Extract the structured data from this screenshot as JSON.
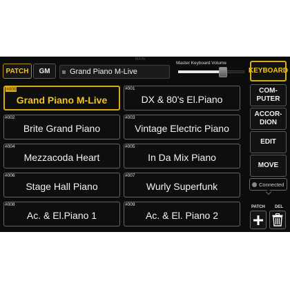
{
  "header": {
    "small_title": "MAIN"
  },
  "tabs": {
    "patch": "PATCH",
    "gm": "GM"
  },
  "current_patch": "Grand Piano M-Live",
  "master_volume": {
    "label": "Master Keyboard Volume",
    "level": 0.68
  },
  "side_buttons": {
    "keyboard": "KEYBOARD",
    "computer": [
      "COM-",
      "PUTER"
    ],
    "accordion": [
      "ACCOR-",
      "DION"
    ],
    "edit": "EDIT",
    "move": "MOVE"
  },
  "status": {
    "text": "Connected",
    "icon": "globe-icon"
  },
  "actions": {
    "patch_label": "PATCH",
    "del_label": "DEL",
    "add_icon": "plus-icon",
    "del_icon": "trash-icon"
  },
  "patches": [
    {
      "num": "#000",
      "name": "Grand Piano M-Live",
      "selected": true
    },
    {
      "num": "#001",
      "name": "DX & 80's El.Piano"
    },
    {
      "num": "#002",
      "name": "Brite Grand Piano"
    },
    {
      "num": "#003",
      "name": "Vintage Electric Piano"
    },
    {
      "num": "#004",
      "name": "Mezzacoda Heart"
    },
    {
      "num": "#005",
      "name": "In Da Mix Piano"
    },
    {
      "num": "#006",
      "name": "Stage Hall Piano"
    },
    {
      "num": "#007",
      "name": "Wurly Superfunk"
    },
    {
      "num": "#008",
      "name": "Ac. & El.Piano 1"
    },
    {
      "num": "#009",
      "name": "Ac. & El. Piano 2"
    }
  ],
  "colors": {
    "accent": "#f3c41a",
    "background": "#0c0c0c"
  }
}
